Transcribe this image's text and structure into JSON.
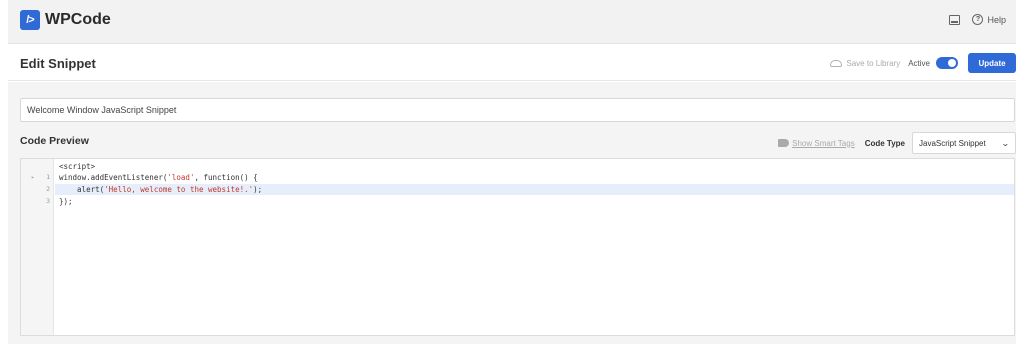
{
  "app": {
    "logo_mark": "/>",
    "logo_text": "WPCode",
    "help_label": "Help"
  },
  "header": {
    "title": "Edit Snippet",
    "save_to_library": "Save to Library",
    "active_label": "Active",
    "active": true,
    "update_label": "Update"
  },
  "snippet": {
    "title_value": "Welcome Window JavaScript Snippet"
  },
  "code_preview": {
    "label": "Code Preview",
    "show_smart_tags": "Show Smart Tags",
    "code_type_label": "Code Type",
    "code_type_value": "JavaScript Snippet",
    "script_tag": "<script>",
    "lines": [
      {
        "num": "1",
        "code": "window.addEventListener('load', function() {"
      },
      {
        "num": "2",
        "code": "    alert('Hello, welcome to the website!.');"
      },
      {
        "num": "3",
        "code": "});"
      }
    ]
  },
  "colors": {
    "accent": "#2f6ad6",
    "highlight_line": "#e6eefb",
    "string": "#c0392b"
  },
  "icons": [
    "logo-icon",
    "inbox-icon",
    "help-icon",
    "cloud-icon",
    "toggle",
    "tag-icon",
    "chevron-down-icon",
    "fold-arrow-icon"
  ]
}
